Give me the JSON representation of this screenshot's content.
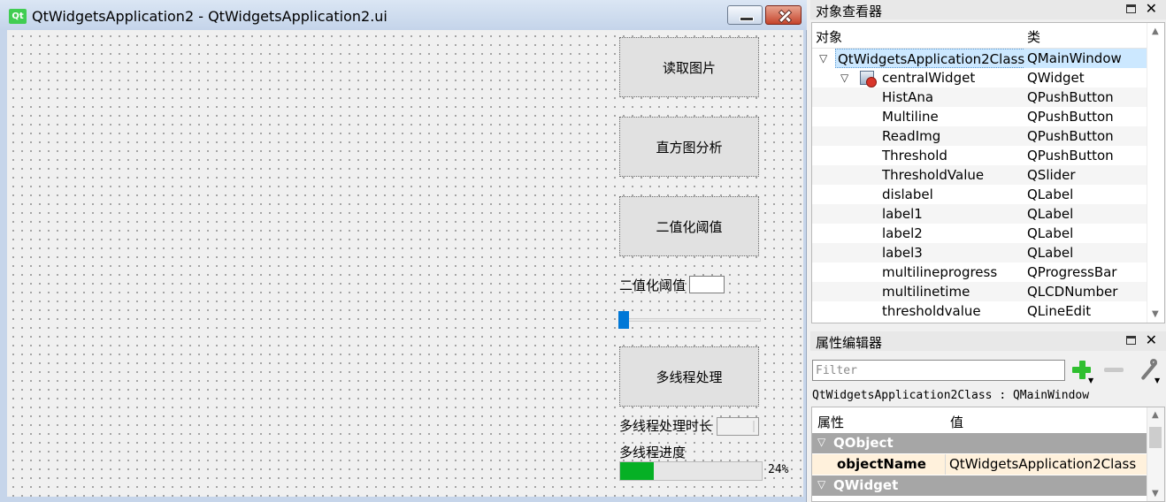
{
  "form_window": {
    "logo": "Qt",
    "title": "QtWidgetsApplication2 - QtWidgetsApplication2.ui",
    "buttons": {
      "read_image": "读取图片",
      "histogram": "直方图分析",
      "binarize": "二值化阈值",
      "multithread": "多线程处理"
    },
    "threshold_label": "二值化阈值",
    "threshold_value": "",
    "slider_value": 0,
    "time_label": "多线程处理时长",
    "progress_label": "多线程进度",
    "progress_fraction": 0.24,
    "progress_text": "24%"
  },
  "object_inspector": {
    "title": "对象查看器",
    "col_object": "对象",
    "col_class": "类",
    "root": {
      "name": "QtWidgetsApplication2Class",
      "class": "QMainWindow"
    },
    "central": {
      "name": "centralWidget",
      "class": "QWidget"
    },
    "children": [
      {
        "name": "HistAna",
        "class": "QPushButton"
      },
      {
        "name": "Multiline",
        "class": "QPushButton"
      },
      {
        "name": "ReadImg",
        "class": "QPushButton"
      },
      {
        "name": "Threshold",
        "class": "QPushButton"
      },
      {
        "name": "ThresholdValue",
        "class": "QSlider"
      },
      {
        "name": "dislabel",
        "class": "QLabel"
      },
      {
        "name": "label1",
        "class": "QLabel"
      },
      {
        "name": "label2",
        "class": "QLabel"
      },
      {
        "name": "label3",
        "class": "QLabel"
      },
      {
        "name": "multilineprogress",
        "class": "QProgressBar"
      },
      {
        "name": "multilinetime",
        "class": "QLCDNumber"
      },
      {
        "name": "thresholdvalue",
        "class": "QLineEdit"
      }
    ]
  },
  "property_editor": {
    "title": "属性编辑器",
    "filter_placeholder": "Filter",
    "caption": "QtWidgetsApplication2Class : QMainWindow",
    "col_property": "属性",
    "col_value": "值",
    "group_qobject": "QObject",
    "prop_name": "objectName",
    "prop_value": "QtWidgetsApplication2Class",
    "group_qwidget": "QWidget"
  },
  "icons": {
    "expand": "chevron-down-icon",
    "widget": "widget-icon",
    "add": "plus-icon",
    "remove": "minus-icon",
    "configure": "wrench-icon"
  },
  "colors": {
    "selection": "#cce8ff",
    "slider": "#0078d7",
    "progress": "#06b025",
    "group_header": "#a6a6a6",
    "highlight_row": "#fff1dc"
  }
}
